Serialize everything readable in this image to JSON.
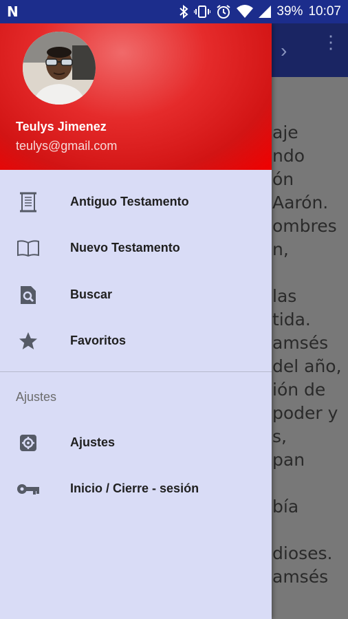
{
  "status_bar": {
    "logo": "N",
    "battery": "39%",
    "time": "10:07"
  },
  "background": {
    "lines": [
      "aje",
      "ndo",
      "ón",
      "Aarón.",
      "ombres",
      "n,",
      "",
      "las",
      "tida.",
      "amsés",
      "del año,",
      "ión de",
      "poder y",
      "s,",
      "pan",
      "",
      "bía",
      "",
      "dioses.",
      "amsés"
    ]
  },
  "drawer": {
    "user": {
      "name": "Teulys Jimenez",
      "email": "teulys@gmail.com"
    },
    "items": [
      {
        "label": "Antiguo Testamento",
        "icon": "scroll-icon"
      },
      {
        "label": "Nuevo Testamento",
        "icon": "open-book-icon"
      },
      {
        "label": "Buscar",
        "icon": "search-document-icon"
      },
      {
        "label": "Favoritos",
        "icon": "star-icon"
      }
    ],
    "section": "Ajustes",
    "settings_items": [
      {
        "label": "Ajustes",
        "icon": "gear-icon"
      },
      {
        "label": "Inicio / Cierre - sesión",
        "icon": "key-icon"
      }
    ]
  },
  "colors": {
    "status_bar": "#1c2d8c",
    "toolbar": "#1a2563",
    "header_red": "#e52b2b",
    "drawer_bg": "#d9dcf6"
  }
}
